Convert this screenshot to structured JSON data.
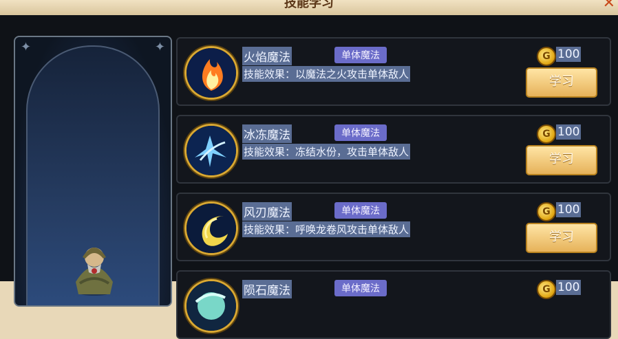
{
  "window": {
    "title": "技能学习"
  },
  "skills": [
    {
      "name": "火焰魔法",
      "tag": "单体魔法",
      "effect": "技能效果：以魔法之火攻击单体敌人",
      "cost": "100",
      "button": "学习",
      "icon": "fire-icon"
    },
    {
      "name": "冰冻魔法",
      "tag": "单体魔法",
      "effect": "技能效果：冻结水份，攻击单体敌人",
      "cost": "100",
      "button": "学习",
      "icon": "ice-icon"
    },
    {
      "name": "风刃魔法",
      "tag": "单体魔法",
      "effect": "技能效果：呼唤龙卷风攻击单体敌人",
      "cost": "100",
      "button": "学习",
      "icon": "wind-blade-icon"
    },
    {
      "name": "陨石魔法",
      "tag": "单体魔法",
      "effect": "",
      "cost": "100",
      "button": "",
      "icon": "meteor-icon"
    }
  ]
}
